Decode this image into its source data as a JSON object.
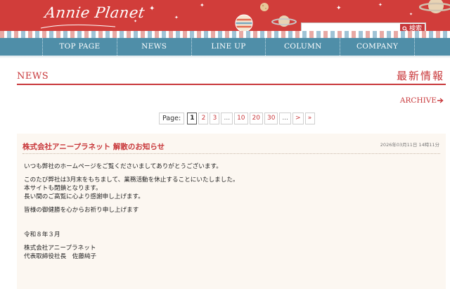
{
  "header": {
    "logo_text": "Annie Planet",
    "search": {
      "placeholder": "",
      "button_label": "検索"
    }
  },
  "nav": {
    "items": [
      {
        "label": "TOP PAGE"
      },
      {
        "label": "NEWS"
      },
      {
        "label": "LINE UP"
      },
      {
        "label": "COLUMN"
      },
      {
        "label": "COMPANY"
      }
    ]
  },
  "page": {
    "title_en": "NEWS",
    "title_jp": "最新情報",
    "archive_label": "ARCHIVE"
  },
  "pagination": {
    "label": "Page:",
    "current": "1",
    "pages": [
      "2",
      "3"
    ],
    "ellipsis": "...",
    "far_pages": [
      "10",
      "20",
      "30"
    ],
    "next": ">",
    "last": "»"
  },
  "article": {
    "title": "株式会社アニープラネット 解散のお知らせ",
    "date": "2026年03月11日 14時11分",
    "p1": "いつも弊社のホームページをご覧くださいましてありがとうございます。",
    "p2": [
      "このたび弊社は3月末をもちまして、業務活動を休止することにいたしました。",
      "本サイトも閉鎖となります。",
      "長い間のご高覧に心より感謝申し上げます。"
    ],
    "p3": "皆様の御健勝を心からお祈り申し上げます",
    "sign_date": "令和８年３月",
    "company": "株式会社アニープラネット",
    "signer": "代表取締役社長　佐藤純子"
  },
  "colors": {
    "brand_red": "#d13d3a",
    "nav_blue": "#4f8ea8",
    "article_bg": "#fcf7f1"
  }
}
